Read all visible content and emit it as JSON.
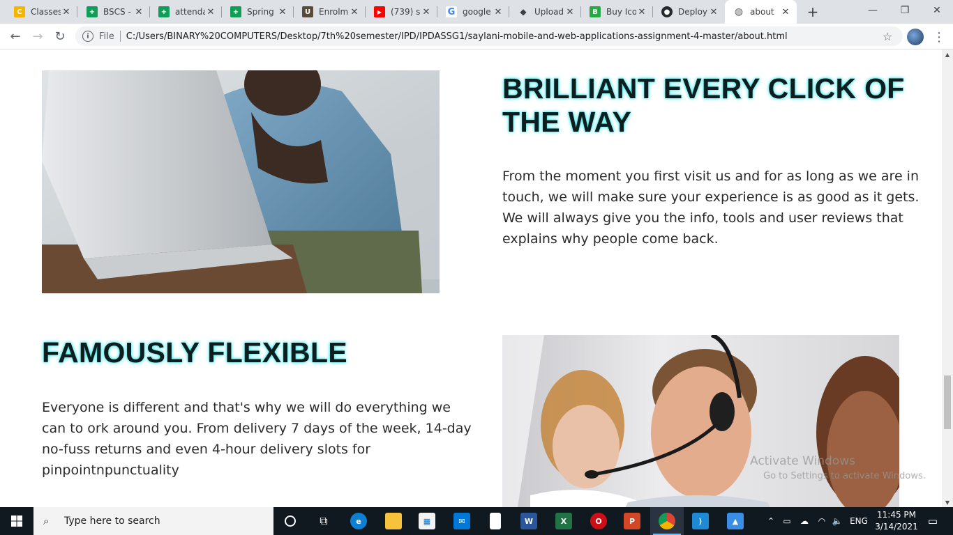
{
  "browser": {
    "tabs": [
      {
        "label": "Classes",
        "icon": "google-classroom-icon",
        "color": "#f4b400",
        "glyph": "C"
      },
      {
        "label": "BSCS -",
        "icon": "google-sheets-icon",
        "color": "#0f9d58",
        "glyph": "+"
      },
      {
        "label": "attenda",
        "icon": "google-sheets-icon",
        "color": "#0f9d58",
        "glyph": "+"
      },
      {
        "label": "Spring",
        "icon": "google-sheets-icon",
        "color": "#0f9d58",
        "glyph": "+"
      },
      {
        "label": "Enrolm",
        "icon": "university-logo-icon",
        "color": "#5a4a3a",
        "glyph": "U"
      },
      {
        "label": "(739) s",
        "icon": "youtube-icon",
        "color": "#ff0000",
        "glyph": "▶"
      },
      {
        "label": "google",
        "icon": "google-icon",
        "color": "#4285f4",
        "glyph": "G"
      },
      {
        "label": "Upload",
        "icon": "graduation-cap-icon",
        "color": "#3c4043",
        "glyph": "◆"
      },
      {
        "label": "Buy Ico",
        "icon": "icon-store-icon",
        "color": "#28a745",
        "glyph": "B"
      },
      {
        "label": "Deploy",
        "icon": "github-icon",
        "color": "#24292e",
        "glyph": "●"
      },
      {
        "label": "about",
        "icon": "globe-icon",
        "color": "#5f6368",
        "glyph": "◍"
      }
    ],
    "url_scheme_chip": "File",
    "url": "C:/Users/BINARY%20COMPUTERS/Desktop/7th%20semester/IPD/IPDASSG1/saylani-mobile-and-web-applications-assignment-4-master/about.html"
  },
  "page": {
    "section1": {
      "heading_line1": "BRILLIANT EVERY CLICK OF",
      "heading_line2": "THE WAY",
      "para_lines": [
        "From the moment you first visit us and for as long as we are in",
        "touch, we will make sure your experience is as good as it gets.",
        "We will always give you the info, tools and user reviews that",
        "explains why people come back."
      ]
    },
    "section2": {
      "heading": "FAMOUSLY FLEXIBLE",
      "para_lines": [
        "Everyone is different and that's why we will do everything we",
        "can to ork around you. From delivery 7 days of the week, 14-day",
        "no-fuss returns and even 4-hour delivery slots for",
        "pinpointnpunctuality"
      ]
    },
    "watermark": {
      "line1": "Activate Windows",
      "line2": "Go to Settings to activate Windows."
    }
  },
  "taskbar": {
    "search_placeholder": "Type here to search",
    "pinned": [
      "cortana-icon",
      "task-view-icon",
      "edge-icon",
      "file-explorer-icon",
      "store-icon",
      "mail-icon",
      "notepad-icon",
      "word-icon",
      "excel-icon",
      "opera-icon",
      "powerpoint-icon",
      "chrome-icon",
      "vscode-icon",
      "photos-icon"
    ],
    "language": "ENG",
    "time": "11:45 PM",
    "date": "3/14/2021"
  }
}
